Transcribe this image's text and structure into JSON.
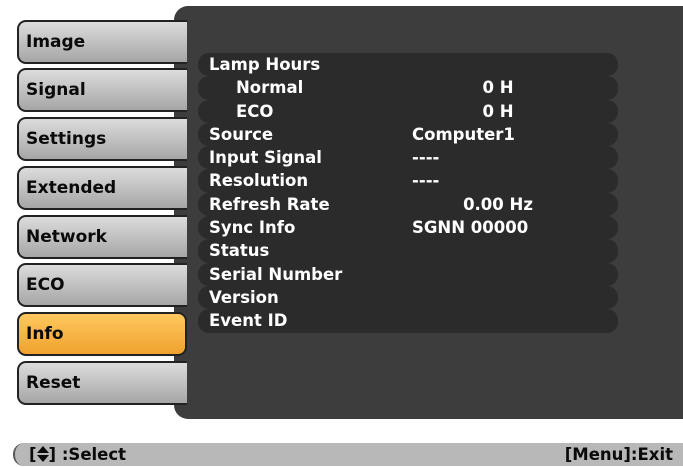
{
  "sidebar": {
    "items": [
      {
        "label": "Image"
      },
      {
        "label": "Signal"
      },
      {
        "label": "Settings"
      },
      {
        "label": "Extended"
      },
      {
        "label": "Network"
      },
      {
        "label": "ECO"
      },
      {
        "label": "Info",
        "selected": true
      },
      {
        "label": "Reset"
      }
    ]
  },
  "info": {
    "rows": [
      {
        "label": "Lamp Hours",
        "value": ""
      },
      {
        "label": "Normal",
        "value": "0 H",
        "sub": true
      },
      {
        "label": "ECO",
        "value": "0 H",
        "sub": true
      },
      {
        "label": "Source",
        "value": "Computer1"
      },
      {
        "label": "Input Signal",
        "value": "----"
      },
      {
        "label": "Resolution",
        "value": "----"
      },
      {
        "label": "Refresh Rate",
        "value": "0.00 Hz"
      },
      {
        "label": "Sync Info",
        "value": "SGNN 00000"
      },
      {
        "label": "Status",
        "value": ""
      },
      {
        "label": "Serial Number",
        "value": ""
      },
      {
        "label": "Version",
        "value": ""
      },
      {
        "label": "Event ID",
        "value": ""
      }
    ]
  },
  "statusbar": {
    "select_open": "[",
    "select_icon": "up-down-arrow-icon",
    "select_close": "] :Select",
    "exit": "[Menu]:Exit"
  },
  "colors": {
    "panel_bg": "#3d3d3d",
    "row_bg": "#2b2b2b",
    "tab_bg": "#c0c0c0",
    "tab_selected_bg": "#f5b443",
    "statusbar_bg": "#b8b8b8"
  }
}
